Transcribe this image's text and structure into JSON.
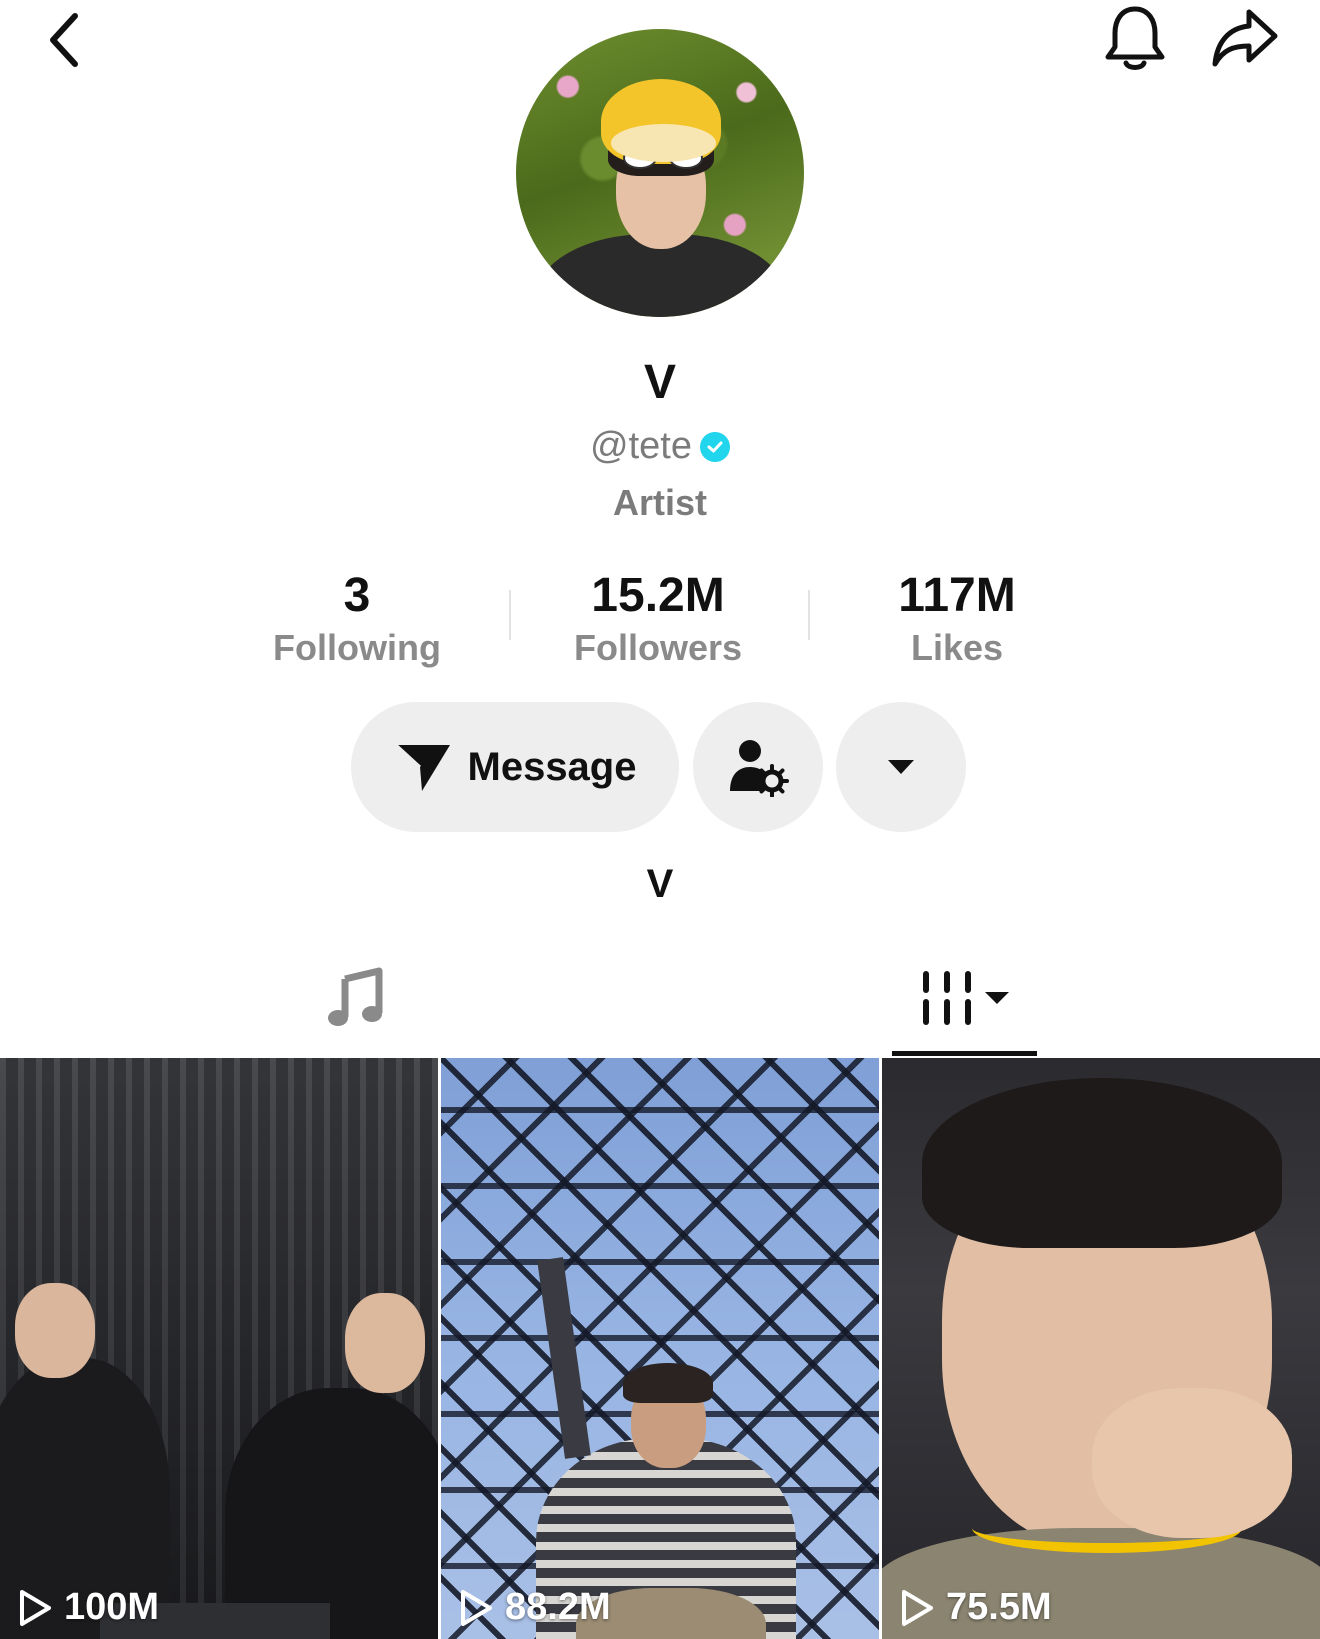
{
  "profile": {
    "display_name": "V",
    "handle": "@tete",
    "role": "Artist",
    "bio": "V"
  },
  "stats": {
    "following": {
      "value": "3",
      "label": "Following"
    },
    "followers": {
      "value": "15.2M",
      "label": "Followers"
    },
    "likes": {
      "value": "117M",
      "label": "Likes"
    }
  },
  "actions": {
    "message_label": "Message"
  },
  "icons": {
    "back": "chevron-left-icon",
    "bell": "bell-icon",
    "share": "share-arrow-icon",
    "verified": "verified-badge-icon",
    "message": "send-icon",
    "friend_settings": "user-gear-icon",
    "more": "caret-down-icon",
    "music_tab": "music-note-icon",
    "videos_tab": "grid-columns-icon",
    "play": "play-outline-icon"
  },
  "colors": {
    "verified": "#20d5ec",
    "button_bg": "#eeeeee",
    "secondary_text": "#7b7b7b"
  },
  "videos": [
    {
      "views": "100M"
    },
    {
      "views": "88.2M"
    },
    {
      "views": "75.5M"
    }
  ]
}
